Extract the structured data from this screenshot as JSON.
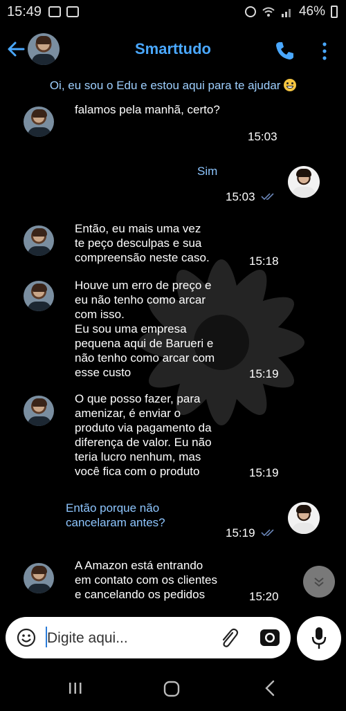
{
  "status_bar": {
    "time": "15:49",
    "battery": "46%",
    "icons": [
      "gallery-icon",
      "email-icon",
      "alarm-icon",
      "wifi-icon",
      "signal-icon",
      "battery-icon"
    ]
  },
  "header": {
    "title": "Smarttudo",
    "icons": [
      "back-arrow-icon",
      "avatar",
      "phone-icon",
      "more-vert-icon"
    ],
    "accent_color": "#4aa8ff"
  },
  "banner": {
    "text": "Oi, eu sou o Edu e estou aqui para te ajudar",
    "emoji": "grinning-face-emoji"
  },
  "messages": [
    {
      "direction": "incoming",
      "text": "falamos pela manhã, certo?",
      "time": "15:03"
    },
    {
      "direction": "outgoing",
      "text": "Sim",
      "time": "15:03",
      "status": "read-ticks"
    },
    {
      "direction": "incoming",
      "text": "Então, eu mais uma vez\nte peço desculpas e sua\ncompreensão neste caso.",
      "time": "15:18"
    },
    {
      "direction": "incoming",
      "text": "Houve um erro de preço e\neu não tenho como arcar\ncom isso.\nEu sou uma empresa\npequena aqui de Barueri e\nnão tenho como arcar com\nesse custo",
      "time": "15:19"
    },
    {
      "direction": "incoming",
      "text": "O que posso fazer, para\namenizar, é enviar o\nproduto via pagamento da\ndiferença de valor. Eu não\nteria lucro nenhum, mas\nvocê fica com o produto",
      "time": "15:19"
    },
    {
      "direction": "outgoing",
      "text": "Então porque não\ncancelaram antes?",
      "time": "15:19",
      "status": "read-ticks"
    },
    {
      "direction": "incoming",
      "text": "A Amazon está entrando\nem contato com os clientes\ne cancelando os pedidos",
      "time": "15:20"
    }
  ],
  "composer": {
    "placeholder": "Digite aqui...",
    "icons": [
      "emoji-icon",
      "attach-icon",
      "camera-icon",
      "mic-icon"
    ]
  },
  "nav_bar": {
    "icons": [
      "recent-apps-icon",
      "home-icon",
      "back-icon"
    ]
  }
}
